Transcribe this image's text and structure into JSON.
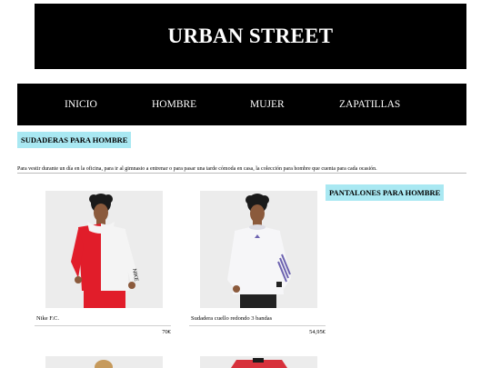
{
  "header": {
    "brand": "URBAN STREET"
  },
  "nav": {
    "items": [
      {
        "label": "INICIO"
      },
      {
        "label": "HOMBRE"
      },
      {
        "label": "MUJER"
      },
      {
        "label": "ZAPATILLAS"
      }
    ]
  },
  "sections": {
    "sudaderas_title": "SUDADERAS PARA HOMBRE",
    "pantalones_title": "PANTALONES PARA HOMBRE",
    "intro": "Para vestir durante un día en la oficina, para ir al gimnasio a entrenar o para pasar una tarde cómoda en casa, la colección para hombre que cuenta para cada ocasión."
  },
  "products": [
    {
      "name": "Nike F.C.",
      "price": "70€",
      "image": "red-white-hoodie-photo"
    },
    {
      "name": "Sudadera cuello redondo 3 bandas",
      "price": "54,95€",
      "image": "white-sweatshirt-photo"
    }
  ],
  "colors": {
    "header_bg": "#000000",
    "nav_bg": "#000000",
    "tag_bg": "#a9e8f2",
    "hoodie_red": "#e11d2a"
  }
}
